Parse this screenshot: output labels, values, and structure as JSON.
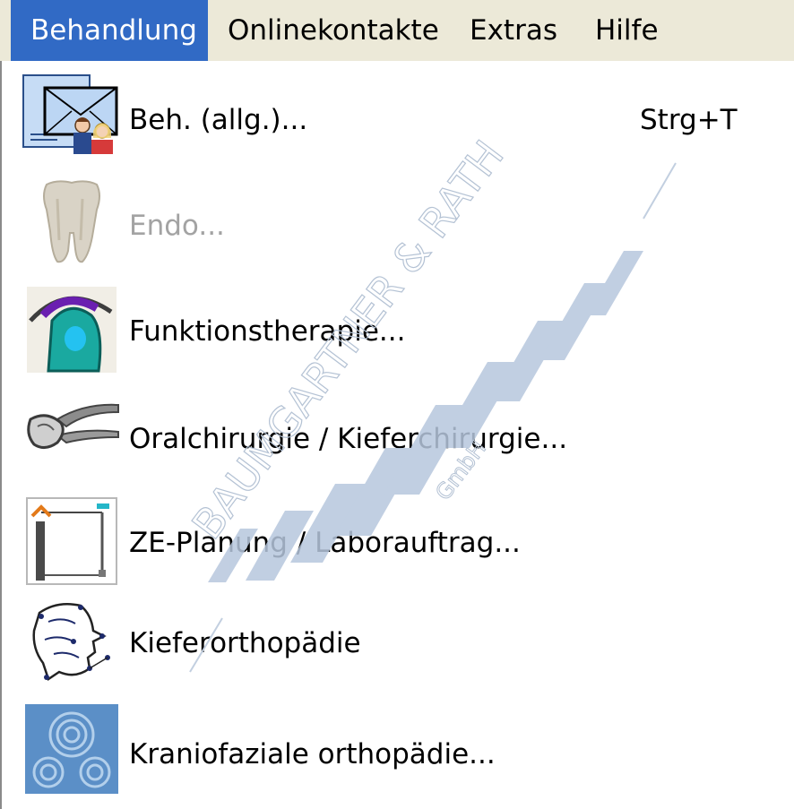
{
  "menubar": {
    "items": [
      {
        "label": "Behandlung",
        "active": true
      },
      {
        "label": "Onlinekontakte"
      },
      {
        "label": "Extras"
      },
      {
        "label": "Hilfe"
      }
    ]
  },
  "menu": {
    "items": [
      {
        "label": "Beh. (allg.)...",
        "shortcut": "Strg+T",
        "icon": "treatment-general-icon",
        "enabled": true
      },
      {
        "label": "Endo...",
        "icon": "tooth-icon",
        "enabled": false
      },
      {
        "label": "Funktionstherapie...",
        "icon": "function-therapy-icon",
        "enabled": true
      },
      {
        "label": "Oralchirurgie / Kieferchirurgie...",
        "icon": "forceps-icon",
        "enabled": true
      },
      {
        "label": "ZE-Planung / Laborauftrag...",
        "icon": "prosthetics-planning-icon",
        "enabled": true
      },
      {
        "label": "Kieferorthopädie",
        "icon": "orthodontics-icon",
        "enabled": true
      },
      {
        "label": "Kraniofaziale orthopädie...",
        "icon": "craniofacial-icon",
        "enabled": true
      }
    ]
  },
  "watermark": {
    "company": "BAUMGARTNER & RATH",
    "suffix": "GmbH"
  },
  "colors": {
    "menubar_bg": "#ece9d8",
    "active_bg": "#316ac5",
    "disabled_text": "#a3a3a3",
    "watermark": "#b7c7dd"
  }
}
